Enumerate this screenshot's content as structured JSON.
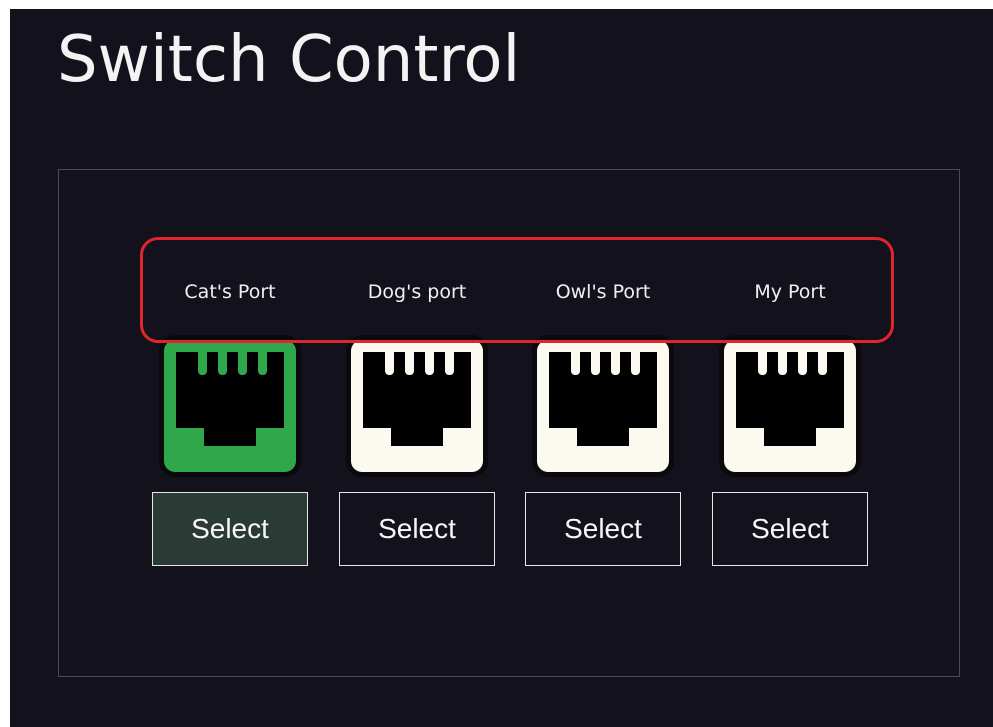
{
  "app": {
    "title": "Switch Control"
  },
  "ports": [
    {
      "label": "Cat's Port",
      "button_label": "Select",
      "selected": true
    },
    {
      "label": "Dog's port",
      "button_label": "Select",
      "selected": false
    },
    {
      "label": "Owl's Port",
      "button_label": "Select",
      "selected": false
    },
    {
      "label": "My Port",
      "button_label": "Select",
      "selected": false
    }
  ],
  "icons": {
    "port": "ethernet-port-icon"
  },
  "colors": {
    "background": "#12111c",
    "selected_port": "#2ea84a",
    "unselected_port": "#fbf9f0",
    "selected_button_fill": "#2a3a34",
    "highlight_outline": "#e0262c"
  }
}
